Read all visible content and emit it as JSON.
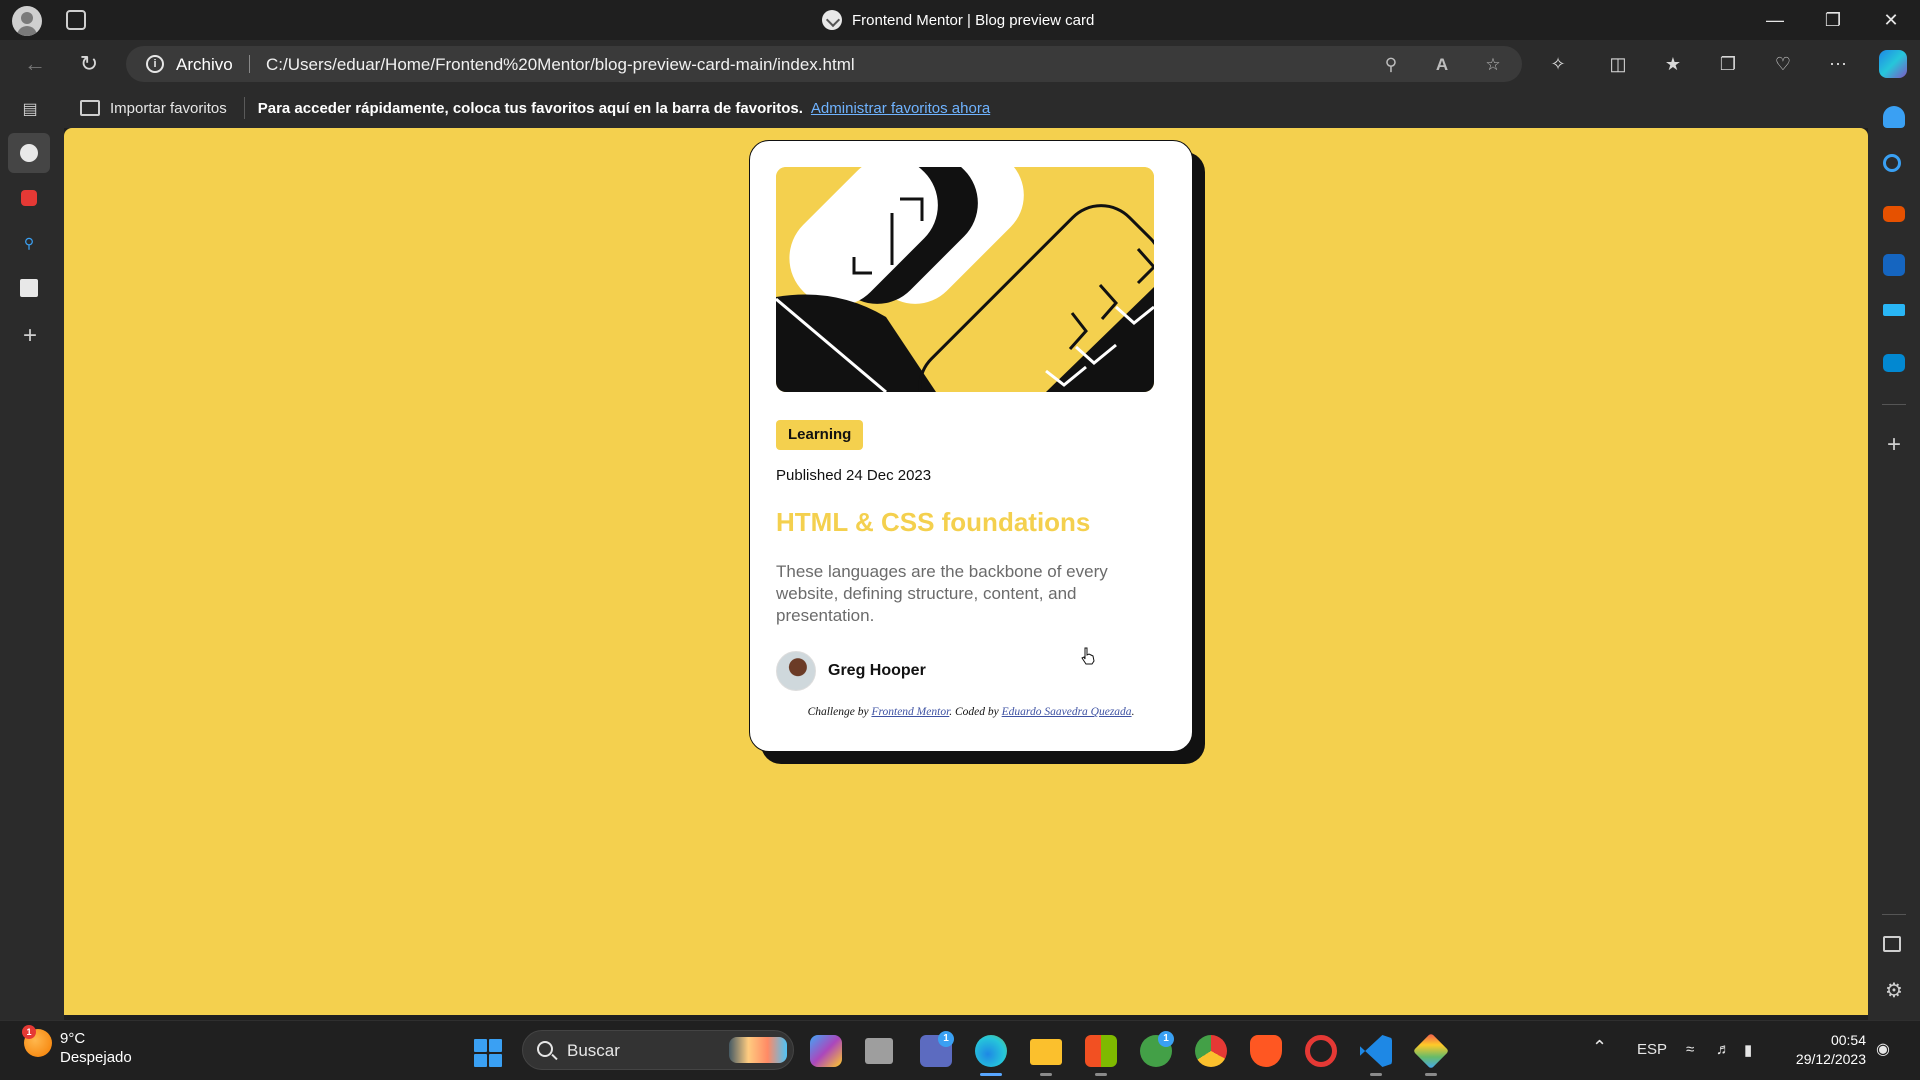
{
  "browser": {
    "tab_title": "Frontend Mentor | Blog preview card",
    "scheme_label": "Archivo",
    "url": "C:/Users/eduar/Home/Frontend%20Mentor/blog-preview-card-main/index.html"
  },
  "favorites_bar": {
    "import_label": "Importar favoritos",
    "message": "Para acceder rápidamente, coloca tus favoritos aquí en la barra de favoritos.",
    "manage_link": "Administrar favoritos ahora"
  },
  "card": {
    "tag": "Learning",
    "published": "Published 24 Dec 2023",
    "title": "HTML & CSS foundations",
    "excerpt": "These languages are the backbone of every website, defining structure, content, and presentation.",
    "author": "Greg Hooper",
    "attribution": {
      "prefix": "Challenge by ",
      "fm_link": "Frontend Mentor",
      "middle": ". Coded by ",
      "author_link": "Eduardo Saavedra Quezada",
      "suffix": "."
    }
  },
  "colors": {
    "page_background": "#f4d04e",
    "title_accent": "#f4d04e",
    "card": "#ffffff",
    "card_border_shadow": "#111111"
  },
  "taskbar": {
    "weather_temp": "9°C",
    "weather_desc": "Despejado",
    "weather_badge": "1",
    "search_label": "Buscar",
    "teams_badge": "1",
    "xbox_badge": "1",
    "language": "ESP",
    "time": "00:54",
    "date": "29/12/2023"
  }
}
